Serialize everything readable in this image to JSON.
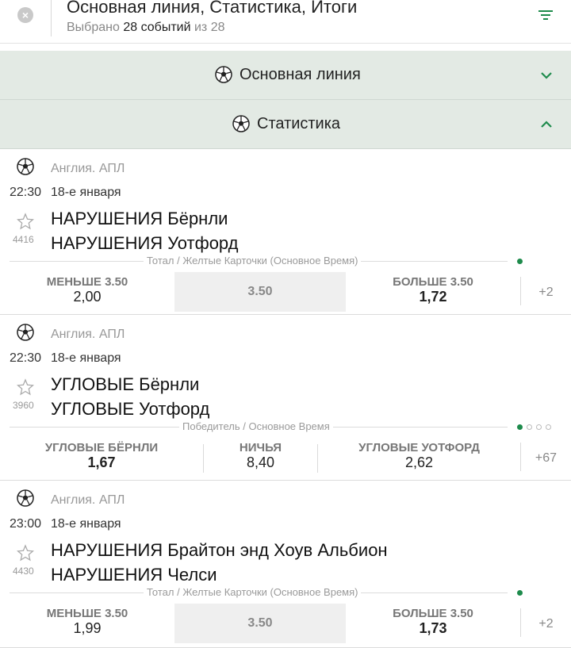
{
  "header": {
    "title": "Основная линия, Статистика, Итоги",
    "selected_prefix": "Выбрано",
    "selected_count": "28 событий",
    "selected_suffix": "из 28",
    "close_glyph": "×"
  },
  "sections": [
    {
      "label": "Основная линия",
      "icon": "soccer-ball-icon",
      "state": "collapsed"
    },
    {
      "label": "Статистика",
      "icon": "soccer-ball-icon",
      "state": "expanded"
    }
  ],
  "events": [
    {
      "league": "Англия. АПЛ",
      "time": "22:30",
      "date": "18-е января",
      "id": "4416",
      "team1": "НАРУШЕНИЯ Бёрнли",
      "team2": "НАРУШЕНИЯ Уотфорд",
      "market": "Тотал / Желтые Карточки (Основное Время)",
      "odds": [
        {
          "label": "МЕНЬШЕ 3.50",
          "value": "2,00",
          "bold": false
        },
        {
          "label": "",
          "value": "3.50",
          "bold": false
        },
        {
          "label": "БОЛЬШЕ 3.50",
          "value": "1,72",
          "bold": true
        }
      ],
      "more": "+2"
    },
    {
      "league": "Англия. АПЛ",
      "time": "22:30",
      "date": "18-е января",
      "id": "3960",
      "team1": "УГЛОВЫЕ Бёрнли",
      "team2": "УГЛОВЫЕ Уотфорд",
      "market": "Победитель / Основное Время",
      "odds": [
        {
          "label": "УГЛОВЫЕ БЁРНЛИ",
          "value": "1,67",
          "bold": true
        },
        {
          "label": "НИЧЬЯ",
          "value": "8,40",
          "bold": false
        },
        {
          "label": "УГЛОВЫЕ УОТФОРД",
          "value": "2,62",
          "bold": false
        }
      ],
      "more": "+67"
    },
    {
      "league": "Англия. АПЛ",
      "time": "23:00",
      "date": "18-е января",
      "id": "4430",
      "team1": "НАРУШЕНИЯ Брайтон энд Хоув Альбион",
      "team2": "НАРУШЕНИЯ Челси",
      "market": "Тотал / Желтые Карточки (Основное Время)",
      "odds": [
        {
          "label": "МЕНЬШЕ 3.50",
          "value": "1,99",
          "bold": false
        },
        {
          "label": "",
          "value": "3.50",
          "bold": false
        },
        {
          "label": "БОЛЬШЕ 3.50",
          "value": "1,73",
          "bold": true
        }
      ],
      "more": "+2"
    }
  ],
  "colors": {
    "accent": "#1e8b4c",
    "section_bg": "#e3eae4",
    "muted": "#999999"
  }
}
